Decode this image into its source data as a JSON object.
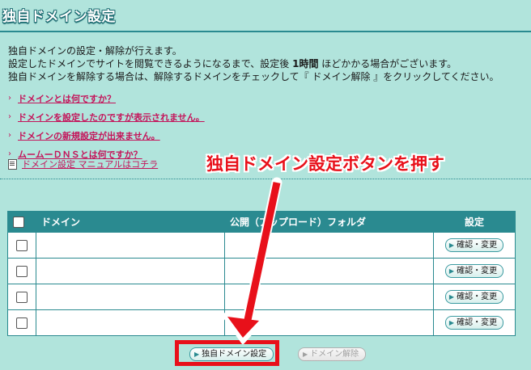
{
  "header": {
    "title": "独自ドメイン設定"
  },
  "intro": {
    "line1": "独自ドメインの設定・解除が行えます。",
    "line2_pre": "設定したドメインでサイトを閲覧できるようになるまで、設定後 ",
    "line2_bold": "1時間",
    "line2_post": " ほどかかる場合がございます。",
    "line3": "独自ドメインを解除する場合は、解除するドメインをチェックして『 ドメイン解除 』をクリックしてください。"
  },
  "faq_links": [
    {
      "label": "ドメインとは何ですか？"
    },
    {
      "label": "ドメインを設定したのですが表示されません。"
    },
    {
      "label": "ドメインの新規設定が出来ません。"
    },
    {
      "label": "ムームーＤＮＳとは何ですか？"
    }
  ],
  "manual_link": {
    "label": "ドメイン設定 マニュアルはコチラ"
  },
  "annotation": {
    "text": "独自ドメイン設定ボタンを押す",
    "color": "#e8101a"
  },
  "table": {
    "headers": {
      "domain": "ドメイン",
      "folder": "公開（アップロード）フォルダ",
      "setting": "設定"
    },
    "rows": [
      {
        "domain": "",
        "folder": "",
        "button": "確認・変更"
      },
      {
        "domain": "",
        "folder": "",
        "button": "確認・変更"
      },
      {
        "domain": "",
        "folder": "",
        "button": "確認・変更"
      },
      {
        "domain": "",
        "folder": "",
        "button": "確認・変更"
      }
    ]
  },
  "buttons": {
    "set_domain": "独自ドメイン設定",
    "remove_domain": "ドメイン解除"
  },
  "colors": {
    "background": "#b1e4dc",
    "accent": "#2a8a90",
    "link": "#c4145a",
    "highlight": "#e8101a"
  }
}
